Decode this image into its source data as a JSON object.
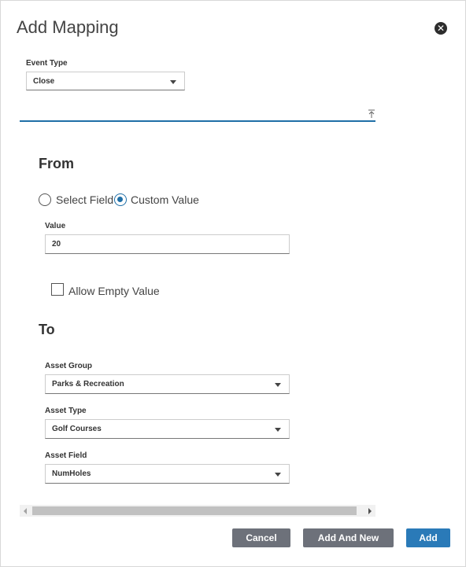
{
  "dialog": {
    "title": "Add Mapping"
  },
  "event_type": {
    "label": "Event Type",
    "value": "Close"
  },
  "from": {
    "heading": "From",
    "options": [
      {
        "label": "Select Field",
        "checked": false
      },
      {
        "label": "Custom Value",
        "checked": true
      }
    ],
    "value_label": "Value",
    "value": "20",
    "allow_empty_label": "Allow Empty Value"
  },
  "to": {
    "heading": "To",
    "asset_group": {
      "label": "Asset Group",
      "value": "Parks & Recreation"
    },
    "asset_type": {
      "label": "Asset Type",
      "value": "Golf Courses"
    },
    "asset_field": {
      "label": "Asset Field",
      "value": "NumHoles"
    }
  },
  "buttons": {
    "cancel": "Cancel",
    "add_and_new": "Add And New",
    "add": "Add"
  },
  "colors": {
    "accent": "#1f6fa7",
    "primary_button": "#2a7ab8",
    "secondary_button": "#6d717a"
  },
  "icons": {
    "close": "close-circle-icon",
    "collapse": "collapse-up-icon"
  }
}
